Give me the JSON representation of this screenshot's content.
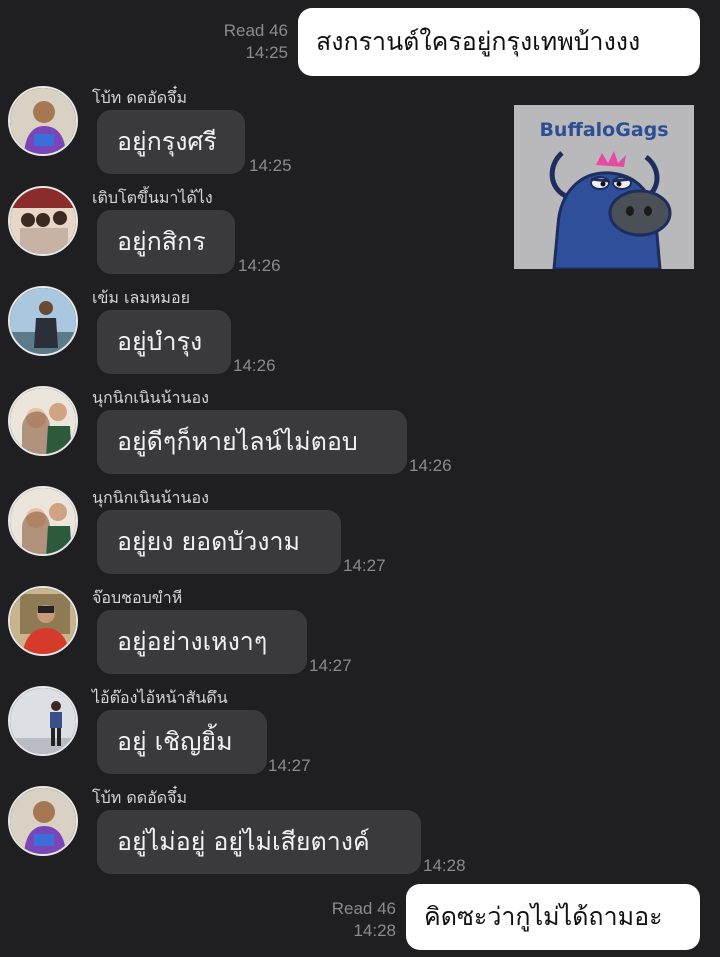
{
  "messages": [
    {
      "dir": "out",
      "text": "สงกรานต์ใครอยู่กรุงเทพบ้างงง",
      "read": "Read 46",
      "time": "14:25"
    },
    {
      "dir": "in",
      "sender": "โบ้ท ดดอัดจึ๋ม",
      "text": "อยู่กรุงศรี",
      "time": "14:25"
    },
    {
      "dir": "in",
      "sender": "เติบโตขึ้นมาได้ไง",
      "text": "อยู่กสิกร",
      "time": "14:26"
    },
    {
      "dir": "in",
      "sender": "เข้ม เลมหมอย",
      "text": "อยู่บำรุง",
      "time": "14:26"
    },
    {
      "dir": "in",
      "sender": "นุกนิกเนินน้านอง",
      "text": "อยู่ดีๆก็หายไลน์ไม่ตอบ",
      "time": "14:26"
    },
    {
      "dir": "in",
      "sender": "นุกนิกเนินน้านอง",
      "text": "อยู่ยง ยอดบัวงาม",
      "time": "14:27"
    },
    {
      "dir": "in",
      "sender": "จ๊อบชอบขำหี",
      "text": "อยู่อย่างเหงาๆ",
      "time": "14:27"
    },
    {
      "dir": "in",
      "sender": "ไอ้ต๊องไอ้หน้าสันดึน",
      "text": "อยู่ เชิญยิ้ม",
      "time": "14:27"
    },
    {
      "dir": "in",
      "sender": "โบ้ท ดดอัดจึ๋ม",
      "text": "อยู่ไม่อยู่ อยู่ไม่เสียตางค์",
      "time": "14:28"
    },
    {
      "dir": "out",
      "text": "คิดซะว่ากูไม่ได้ถามอะ",
      "read": "Read 46",
      "time": "14:28"
    }
  ],
  "sticker": {
    "title": "BuffaloGags",
    "icon": "buffalo-sticker"
  },
  "colors": {
    "background": "#1f1f21",
    "incoming_bubble": "#3a3a3c",
    "outgoing_bubble": "#ffffff",
    "meta_text": "#8b8b8f"
  }
}
